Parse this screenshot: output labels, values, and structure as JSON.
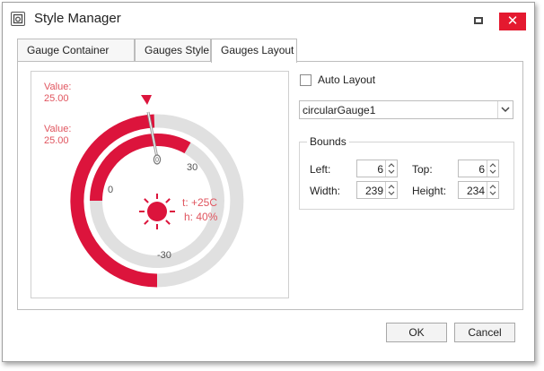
{
  "window": {
    "title": "Style Manager",
    "close_glyph": "✕",
    "icons": [
      "app-icon",
      "minimize-icon",
      "close-icon"
    ]
  },
  "tabs": [
    {
      "label": "Gauge Container Style"
    },
    {
      "label": "Gauges Style"
    },
    {
      "label": "Gauges Layout",
      "active": true
    }
  ],
  "preview": {
    "outer_value_label": "Value:",
    "outer_value": "25.00",
    "inner_value_label": "Value:",
    "inner_value": "25.00",
    "tick_labels": [
      "30",
      "0",
      "-30"
    ],
    "temperature": "t: +25C",
    "humidity": "h: 40%",
    "colors": {
      "accent": "#dc143c",
      "track": "#e0e0e0",
      "text": "#e0555f",
      "tick": "#555555"
    },
    "icons": [
      "sun-icon",
      "needle-icon",
      "marker-triangle-icon"
    ]
  },
  "auto_layout": {
    "label": "Auto Layout",
    "checked": false
  },
  "gauge_select": {
    "value": "circularGauge1"
  },
  "bounds": {
    "legend": "Bounds",
    "left_label": "Left:",
    "left_value": "6",
    "top_label": "Top:",
    "top_value": "6",
    "width_label": "Width:",
    "width_value": "239",
    "height_label": "Height:",
    "height_value": "234"
  },
  "buttons": {
    "ok": "OK",
    "cancel": "Cancel"
  }
}
